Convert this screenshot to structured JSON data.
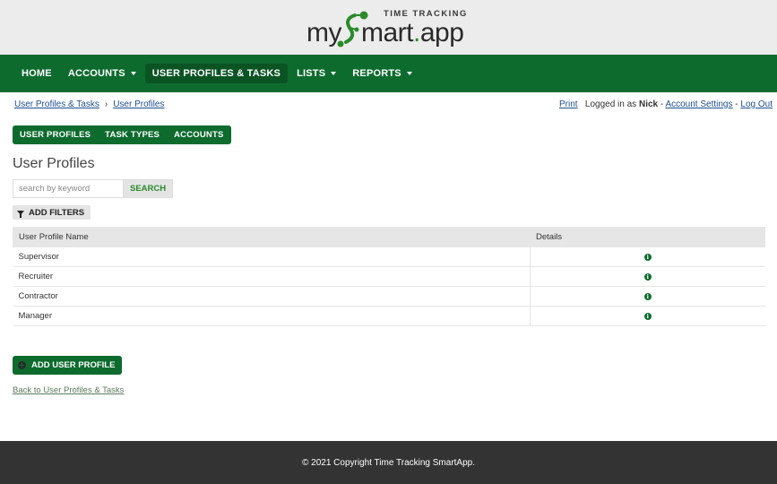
{
  "brand": {
    "tagline": "TIME TRACKING",
    "name_prefix": "my",
    "name_mid": "mart",
    "name_dot": ".",
    "name_suffix": "app",
    "accent_color": "#0d6b2e"
  },
  "nav": {
    "items": [
      {
        "label": "HOME",
        "dropdown": false,
        "active": false
      },
      {
        "label": "ACCOUNTS",
        "dropdown": true,
        "active": false
      },
      {
        "label": "USER PROFILES & TASKS",
        "dropdown": false,
        "active": true
      },
      {
        "label": "LISTS",
        "dropdown": true,
        "active": false
      },
      {
        "label": "REPORTS",
        "dropdown": true,
        "active": false
      }
    ]
  },
  "breadcrumb": {
    "items": [
      "User Profiles & Tasks",
      "User Profiles"
    ],
    "separator": "›"
  },
  "userbar": {
    "print": "Print",
    "logged_in_prefix": "Logged in as",
    "username": "Nick",
    "dash1": "-",
    "account_settings": "Account Settings",
    "dash2": "-",
    "logout": "Log Out"
  },
  "subtabs": [
    "USER PROFILES",
    "TASK TYPES",
    "ACCOUNTS"
  ],
  "page_title": "User Profiles",
  "search": {
    "placeholder": "search by keyword",
    "button": "SEARCH"
  },
  "filters": {
    "label": "ADD FILTERS",
    "icon": "filter-icon"
  },
  "table": {
    "headers": [
      "User Profile Name",
      "Details"
    ],
    "rows": [
      {
        "name": "Supervisor",
        "details_icon": "info-icon"
      },
      {
        "name": "Recruiter",
        "details_icon": "info-icon"
      },
      {
        "name": "Contractor",
        "details_icon": "info-icon"
      },
      {
        "name": "Manager",
        "details_icon": "info-icon"
      }
    ]
  },
  "add_button": {
    "label": "ADD USER PROFILE",
    "icon": "plus-circle-icon"
  },
  "back_link": "Back to User Profiles & Tasks",
  "footer": {
    "copyright": "© 2021 Copyright Time Tracking SmartApp."
  }
}
